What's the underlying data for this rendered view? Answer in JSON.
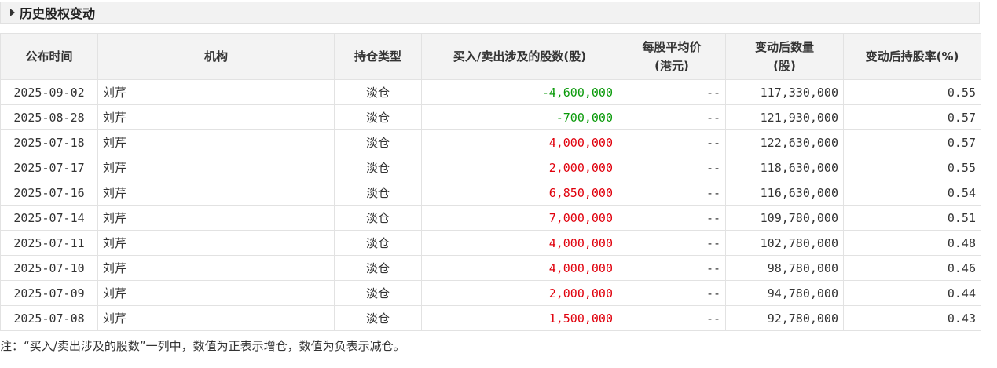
{
  "section": {
    "title": "历史股权变动"
  },
  "table": {
    "headers": {
      "date": "公布时间",
      "org": "机构",
      "type": "持仓类型",
      "shares": "买入/卖出涉及的股数(股)",
      "avg_price_line1": "每股平均价",
      "avg_price_line2": "(港元)",
      "after_qty_line1": "变动后数量",
      "after_qty_line2": "(股)",
      "after_ratio": "变动后持股率(%)"
    },
    "rows": [
      {
        "date": "2025-09-02",
        "org": "刘芹",
        "type": "淡仓",
        "shares": "-4,600,000",
        "dir": "neg",
        "avg": "--",
        "after_qty": "117,330,000",
        "ratio": "0.55"
      },
      {
        "date": "2025-08-28",
        "org": "刘芹",
        "type": "淡仓",
        "shares": "-700,000",
        "dir": "neg",
        "avg": "--",
        "after_qty": "121,930,000",
        "ratio": "0.57"
      },
      {
        "date": "2025-07-18",
        "org": "刘芹",
        "type": "淡仓",
        "shares": "4,000,000",
        "dir": "pos",
        "avg": "--",
        "after_qty": "122,630,000",
        "ratio": "0.57"
      },
      {
        "date": "2025-07-17",
        "org": "刘芹",
        "type": "淡仓",
        "shares": "2,000,000",
        "dir": "pos",
        "avg": "--",
        "after_qty": "118,630,000",
        "ratio": "0.55"
      },
      {
        "date": "2025-07-16",
        "org": "刘芹",
        "type": "淡仓",
        "shares": "6,850,000",
        "dir": "pos",
        "avg": "--",
        "after_qty": "116,630,000",
        "ratio": "0.54"
      },
      {
        "date": "2025-07-14",
        "org": "刘芹",
        "type": "淡仓",
        "shares": "7,000,000",
        "dir": "pos",
        "avg": "--",
        "after_qty": "109,780,000",
        "ratio": "0.51"
      },
      {
        "date": "2025-07-11",
        "org": "刘芹",
        "type": "淡仓",
        "shares": "4,000,000",
        "dir": "pos",
        "avg": "--",
        "after_qty": "102,780,000",
        "ratio": "0.48"
      },
      {
        "date": "2025-07-10",
        "org": "刘芹",
        "type": "淡仓",
        "shares": "4,000,000",
        "dir": "pos",
        "avg": "--",
        "after_qty": "98,780,000",
        "ratio": "0.46"
      },
      {
        "date": "2025-07-09",
        "org": "刘芹",
        "type": "淡仓",
        "shares": "2,000,000",
        "dir": "pos",
        "avg": "--",
        "after_qty": "94,780,000",
        "ratio": "0.44"
      },
      {
        "date": "2025-07-08",
        "org": "刘芹",
        "type": "淡仓",
        "shares": "1,500,000",
        "dir": "pos",
        "avg": "--",
        "after_qty": "92,780,000",
        "ratio": "0.43"
      }
    ]
  },
  "note": "注：“买入/卖出涉及的股数”一列中，数值为正表示增仓，数值为负表示减仓。",
  "colors": {
    "positive": "#e0000c",
    "negative": "#0a9a0a",
    "header_bg": "#f3f3f3"
  }
}
